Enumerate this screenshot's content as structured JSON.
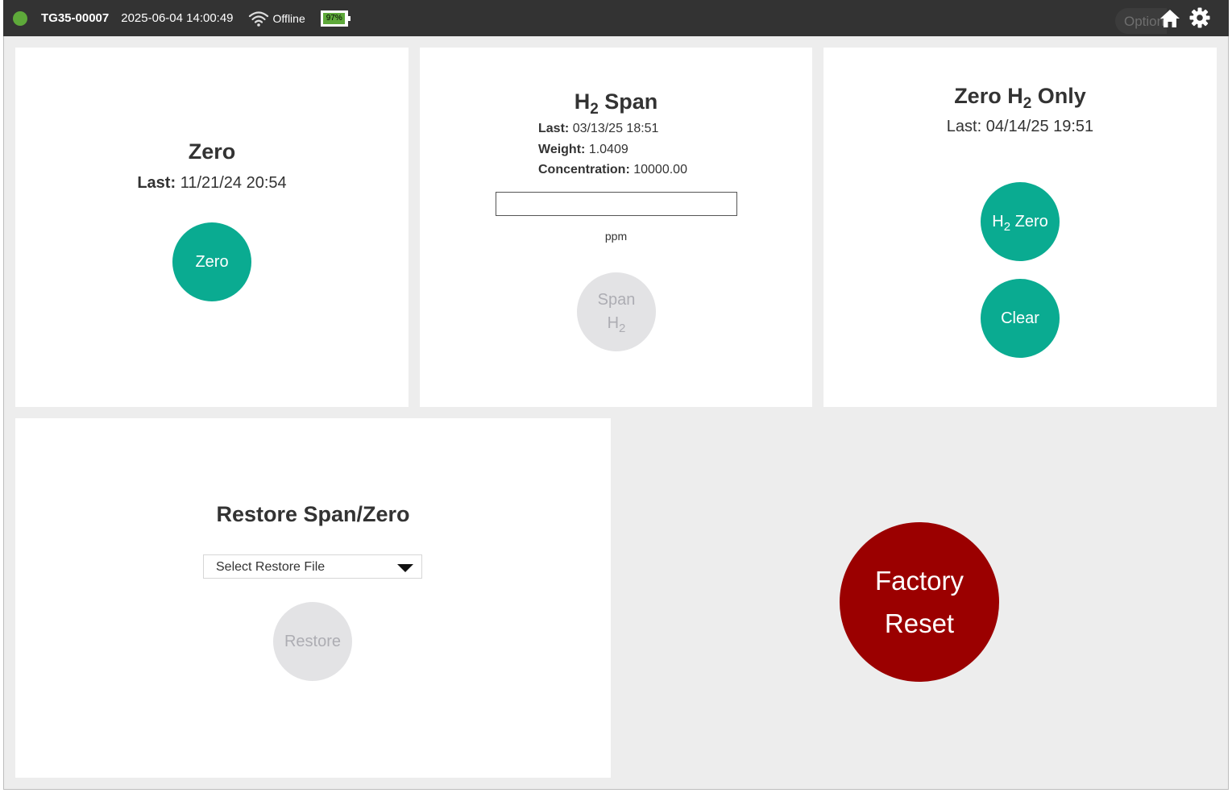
{
  "status_bar": {
    "device_id": "TG35-00007",
    "datetime": "2025-06-04 14:00:49",
    "connection": "Offline",
    "battery_percent": "97%",
    "battery_level": 0.97,
    "options_label": "Options",
    "status_color": "#5ea93a",
    "icons": [
      "wifi-icon",
      "battery-icon",
      "home-icon",
      "gear-icon"
    ]
  },
  "zero_card": {
    "title": "Zero",
    "last_label": "Last:",
    "last_value": "11/21/24 20:54",
    "button_label": "Zero"
  },
  "span_card": {
    "title_main": "H",
    "title_sub": "2",
    "title_rest": "Span",
    "last_label": "Last:",
    "last_value": "03/13/25 18:51",
    "weight_label": "Weight:",
    "weight_value": "1.0409",
    "concentration_label": "Concentration:",
    "concentration_value": "10000.00",
    "input_value": "",
    "unit": "ppm",
    "button_line1": "Span",
    "button_line2_main": "H",
    "button_line2_sub": "2"
  },
  "h2zero_card": {
    "title_main": "Zero H",
    "title_sub": "2",
    "title_rest": "Only",
    "last_label": "Last:",
    "last_value": "04/14/25 19:51",
    "zero_button_main": "H",
    "zero_button_sub": "2",
    "zero_button_rest": "Zero",
    "clear_button": "Clear"
  },
  "restore_card": {
    "title": "Restore Span/Zero",
    "select_value": "Select Restore File",
    "button_label": "Restore"
  },
  "factory_reset": {
    "line1": "Factory",
    "line2": "Reset",
    "color": "#9b0000"
  },
  "colors": {
    "accent": "#0aab91",
    "disabled": "#e3e3e5",
    "topbar": "#333333"
  }
}
